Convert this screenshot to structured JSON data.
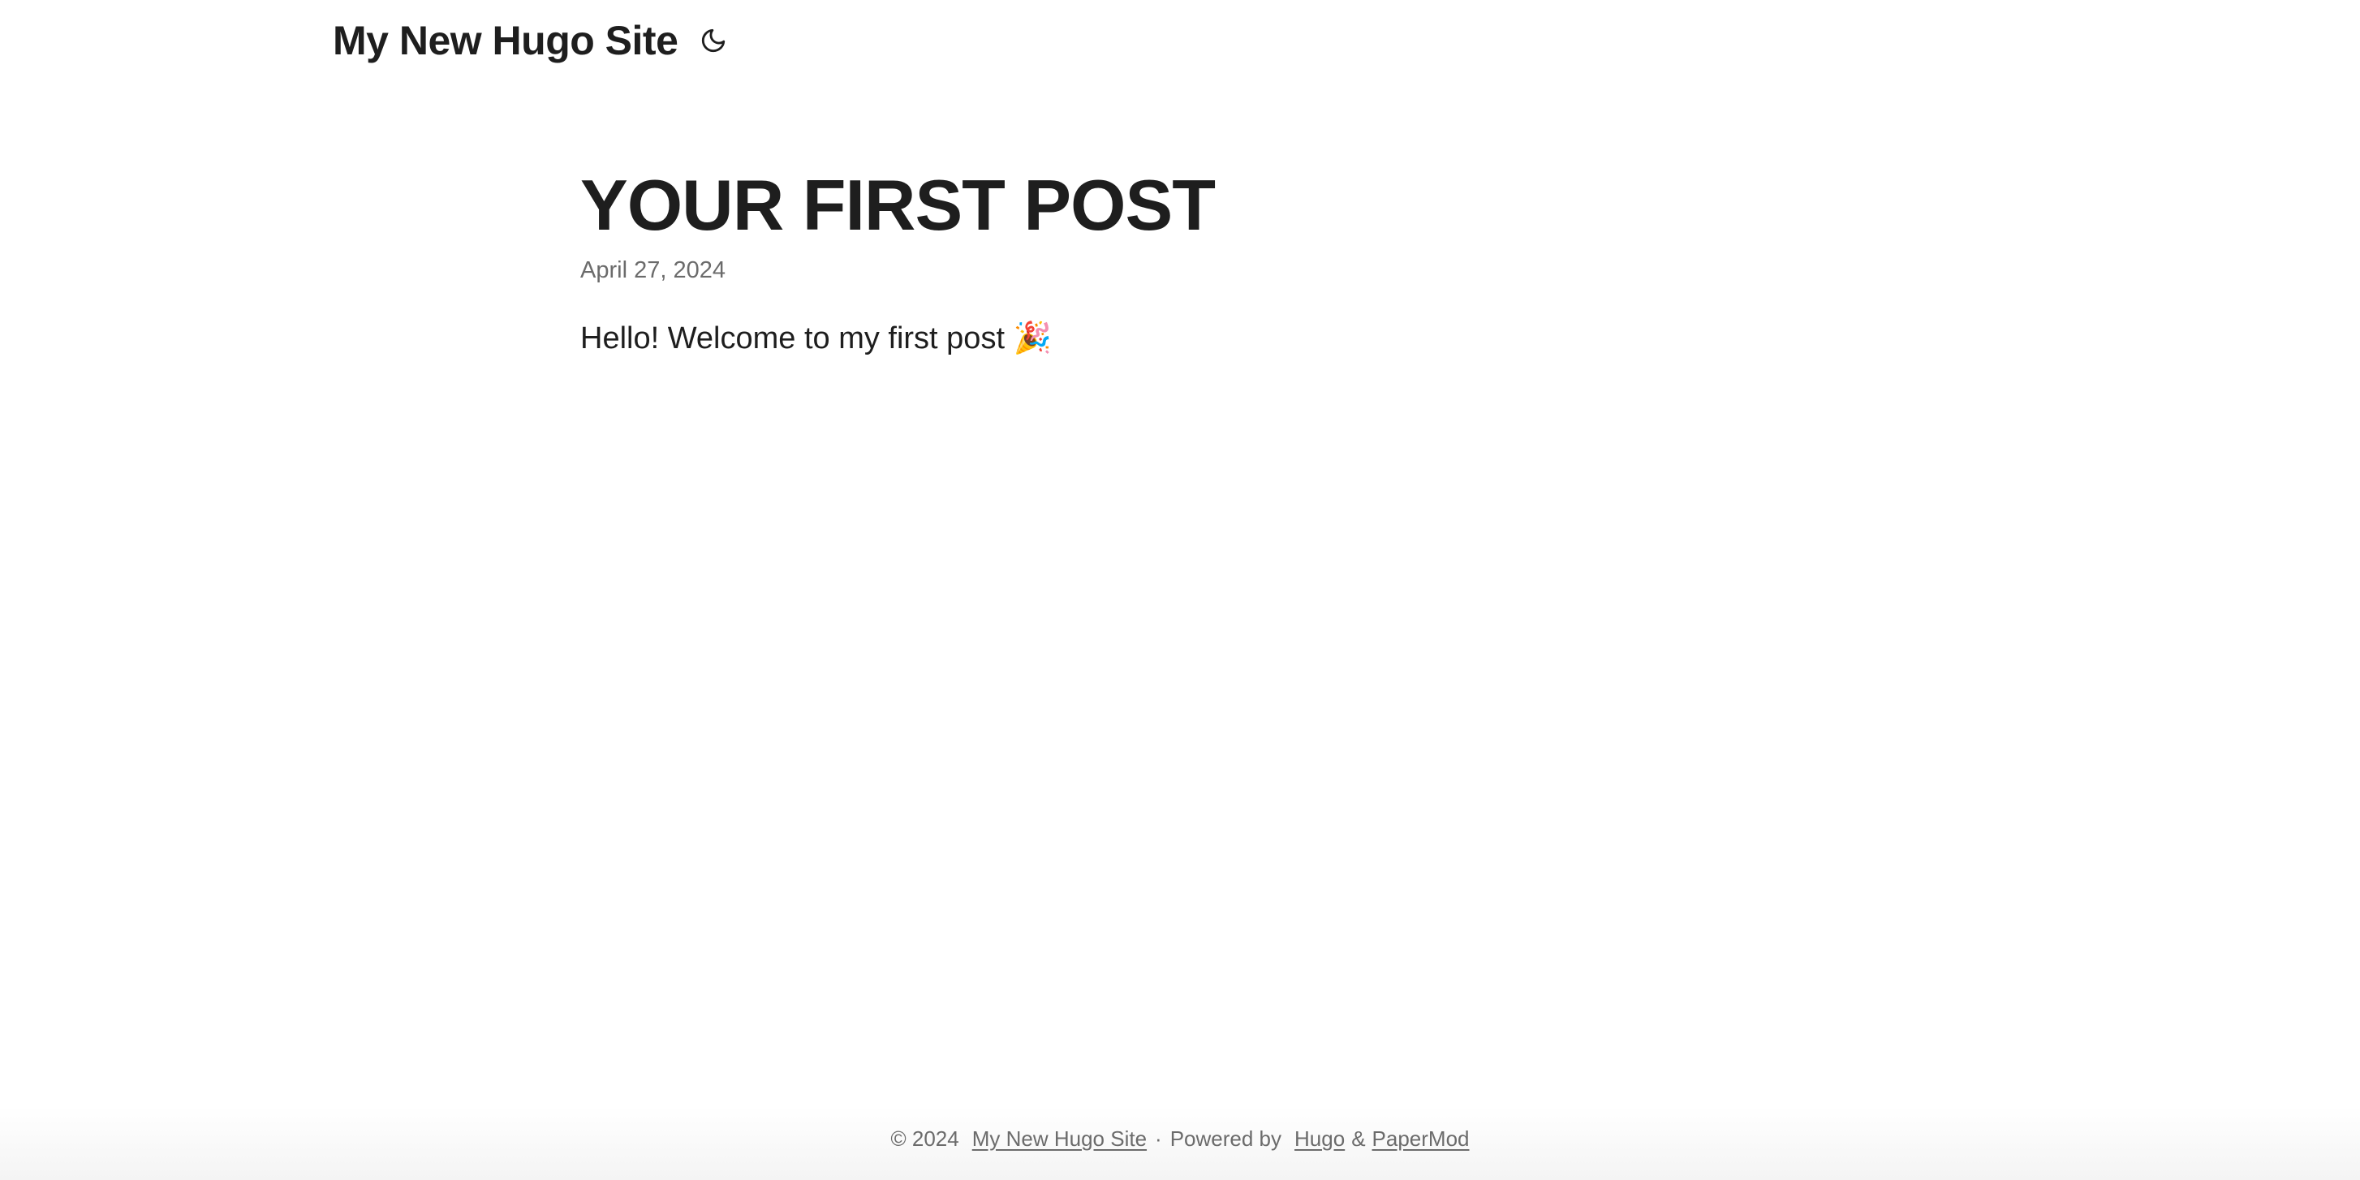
{
  "header": {
    "site_title": "My New Hugo Site",
    "theme_toggle_icon": "moon-icon"
  },
  "post": {
    "title": "YOUR FIRST POST",
    "date": "April 27, 2024",
    "content": "Hello! Welcome to my first post 🎉"
  },
  "footer": {
    "copyright": "© 2024",
    "site_link": "My New Hugo Site",
    "separator": "·",
    "powered_by": "Powered by",
    "hugo_link": "Hugo",
    "ampersand": "&",
    "theme_link": "PaperMod"
  }
}
